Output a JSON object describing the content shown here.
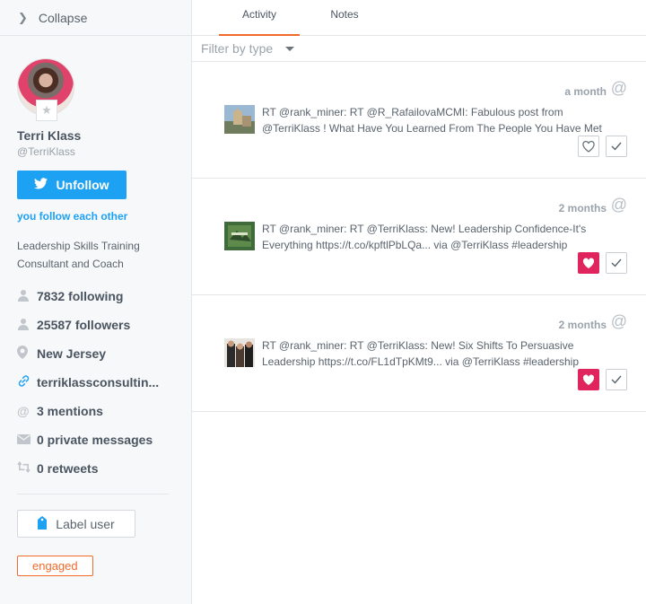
{
  "sidebar": {
    "collapse_label": "Collapse",
    "profile": {
      "name": "Terri Klass",
      "handle": "@TerriKlass",
      "unfollow_label": "Unfollow",
      "follow_each": "you follow each other",
      "bio_line1": "Leadership Skills Training",
      "bio_line2": "Consultant and Coach"
    },
    "stats": [
      {
        "icon": "user-icon",
        "text": "7832 following"
      },
      {
        "icon": "user-icon",
        "text": "25587 followers"
      },
      {
        "icon": "location-pin-icon",
        "text": "New Jersey"
      },
      {
        "icon": "link-icon",
        "text": "terriklassconsultin..."
      },
      {
        "icon": "at-icon",
        "text": "3 mentions"
      },
      {
        "icon": "envelope-icon",
        "text": "0 private messages"
      },
      {
        "icon": "retweet-icon",
        "text": "0 retweets"
      }
    ],
    "label_user": "Label user",
    "engaged_tag": "engaged"
  },
  "main": {
    "tabs": [
      {
        "label": "Activity",
        "active": true
      },
      {
        "label": "Notes",
        "active": false
      }
    ],
    "filter_placeholder": "Filter by type",
    "activity": [
      {
        "time": "a month",
        "line1": "RT @rank_miner: RT @R_RafailovaMCMI: Fabulous post from",
        "line2": "@TerriKlass ! What Have You Learned From The People You Have Met",
        "liked": false
      },
      {
        "time": "2 months",
        "line1": "RT @rank_miner: RT @TerriKlass: New! Leadership Confidence-It's",
        "line2": "Everything https://t.co/kpftlPbLQa... via @TerriKlass #leadership",
        "liked": true
      },
      {
        "time": "2 months",
        "line1": "RT @rank_miner: RT @TerriKlass: New! Six Shifts To Persuasive",
        "line2": "Leadership https://t.co/FL1dTpKMt9... via @TerriKlass #leadership",
        "liked": true
      }
    ]
  },
  "colors": {
    "twitter_blue": "#1da1f2",
    "accent_orange": "#f06a2c",
    "like_red": "#e0245e"
  }
}
